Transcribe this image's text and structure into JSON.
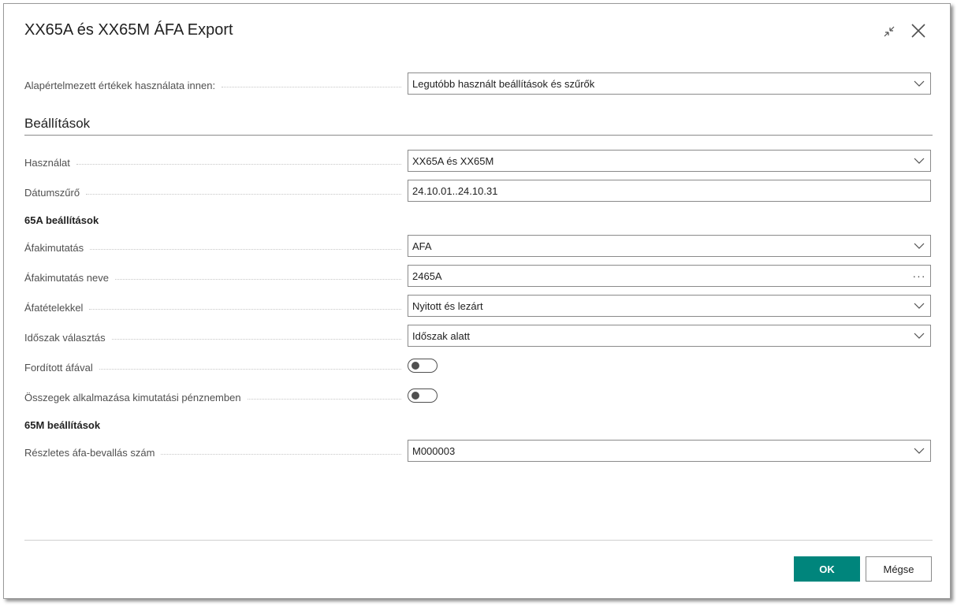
{
  "dialog": {
    "title": "XX65A és XX65M ÁFA Export",
    "collapse_icon": "collapse-icon",
    "close_icon": "close-icon"
  },
  "defaults": {
    "label": "Alapértelmezett értékek használata innen:",
    "value": "Legutóbb használt beállítások és szűrők"
  },
  "settings": {
    "title": "Beállítások",
    "usage": {
      "label": "Használat",
      "value": "XX65A és XX65M"
    },
    "date_filter": {
      "label": "Dátumszűrő",
      "value": "24.10.01..24.10.31"
    },
    "group_65a": {
      "title": "65A beállítások",
      "vat_statement": {
        "label": "Áfakimutatás",
        "value": "AFA"
      },
      "vat_statement_name": {
        "label": "Áfakimutatás neve",
        "value": "2465A"
      },
      "vat_entries": {
        "label": "Áfatételekkel",
        "value": "Nyitott és lezárt"
      },
      "period_selection": {
        "label": "Időszak választás",
        "value": "Időszak alatt"
      },
      "reverse_vat": {
        "label": "Fordított áfával",
        "on": false
      },
      "reporting_currency": {
        "label": "Összegek alkalmazása kimutatási pénznemben",
        "on": false
      }
    },
    "group_65m": {
      "title": "65M beállítások",
      "detailed_return_no": {
        "label": "Részletes áfa-bevallás szám",
        "value": "M000003"
      }
    }
  },
  "footer": {
    "ok_label": "OK",
    "cancel_label": "Mégse"
  },
  "colors": {
    "primary": "#00857c",
    "border": "#8a8a8a",
    "label": "#505050"
  }
}
